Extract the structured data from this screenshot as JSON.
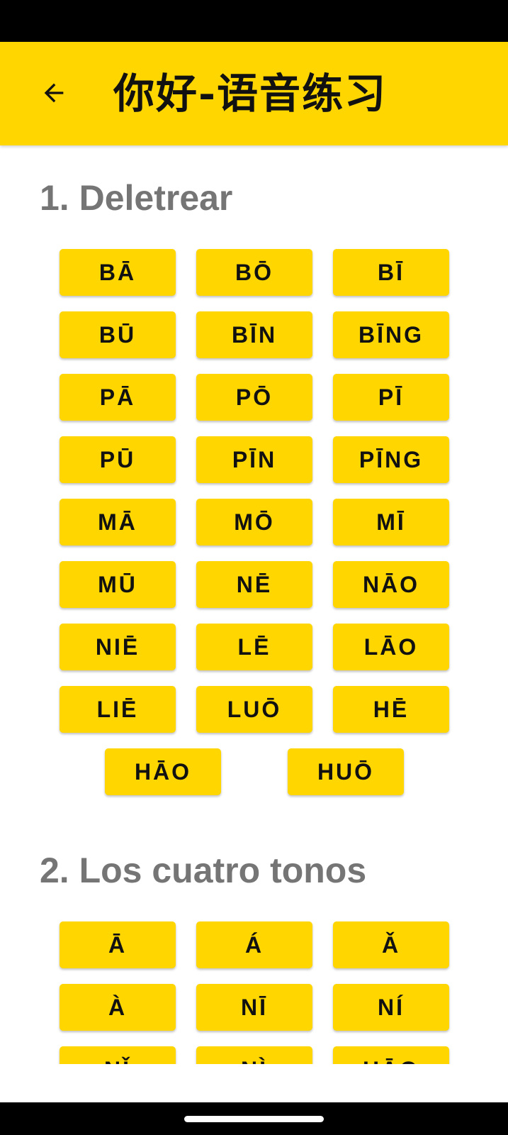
{
  "header": {
    "back_icon": "arrow-left-icon",
    "title": "你好-语音练习"
  },
  "colors": {
    "accent": "#FFD600",
    "section_title": "#757575",
    "text": "#111111",
    "system_bars": "#000000"
  },
  "sections": [
    {
      "title": "1. Deletrear",
      "syllables": [
        "BĀ",
        "BŌ",
        "BĪ",
        "BŪ",
        "BĪN",
        "BĪNG",
        "PĀ",
        "PŌ",
        "PĪ",
        "PŪ",
        "PĪN",
        "PĪNG",
        "MĀ",
        "MŌ",
        "MĪ",
        "MŪ",
        "NĒ",
        "NĀO",
        "NIĒ",
        "LĒ",
        "LĀO",
        "LIĒ",
        "LUŌ",
        "HĒ"
      ],
      "last_row": [
        "HĀO",
        "HUŌ"
      ]
    },
    {
      "title": "2. Los cuatro tonos",
      "syllables": [
        "Ā",
        "Á",
        "Ǎ",
        "À",
        "NĪ",
        "NÍ",
        "NǏ",
        "NÌ",
        "HĀO"
      ]
    }
  ]
}
